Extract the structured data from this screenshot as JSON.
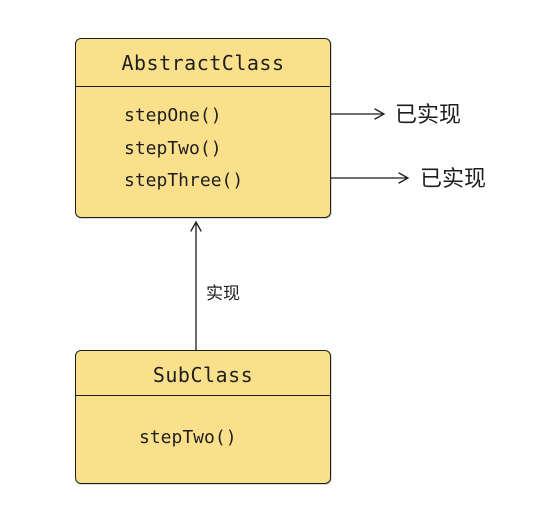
{
  "abstract_class": {
    "name": "AbstractClass",
    "methods": [
      "stepOne()",
      "stepTwo()",
      "stepThree()"
    ]
  },
  "sub_class": {
    "name": "SubClass",
    "methods": [
      "stepTwo()"
    ]
  },
  "annotations": {
    "step_one_note": "已实现",
    "step_three_note": "已实现",
    "inheritance_label": "实现"
  },
  "colors": {
    "box_fill": "#fbe08c",
    "stroke": "#1e1e1e"
  }
}
